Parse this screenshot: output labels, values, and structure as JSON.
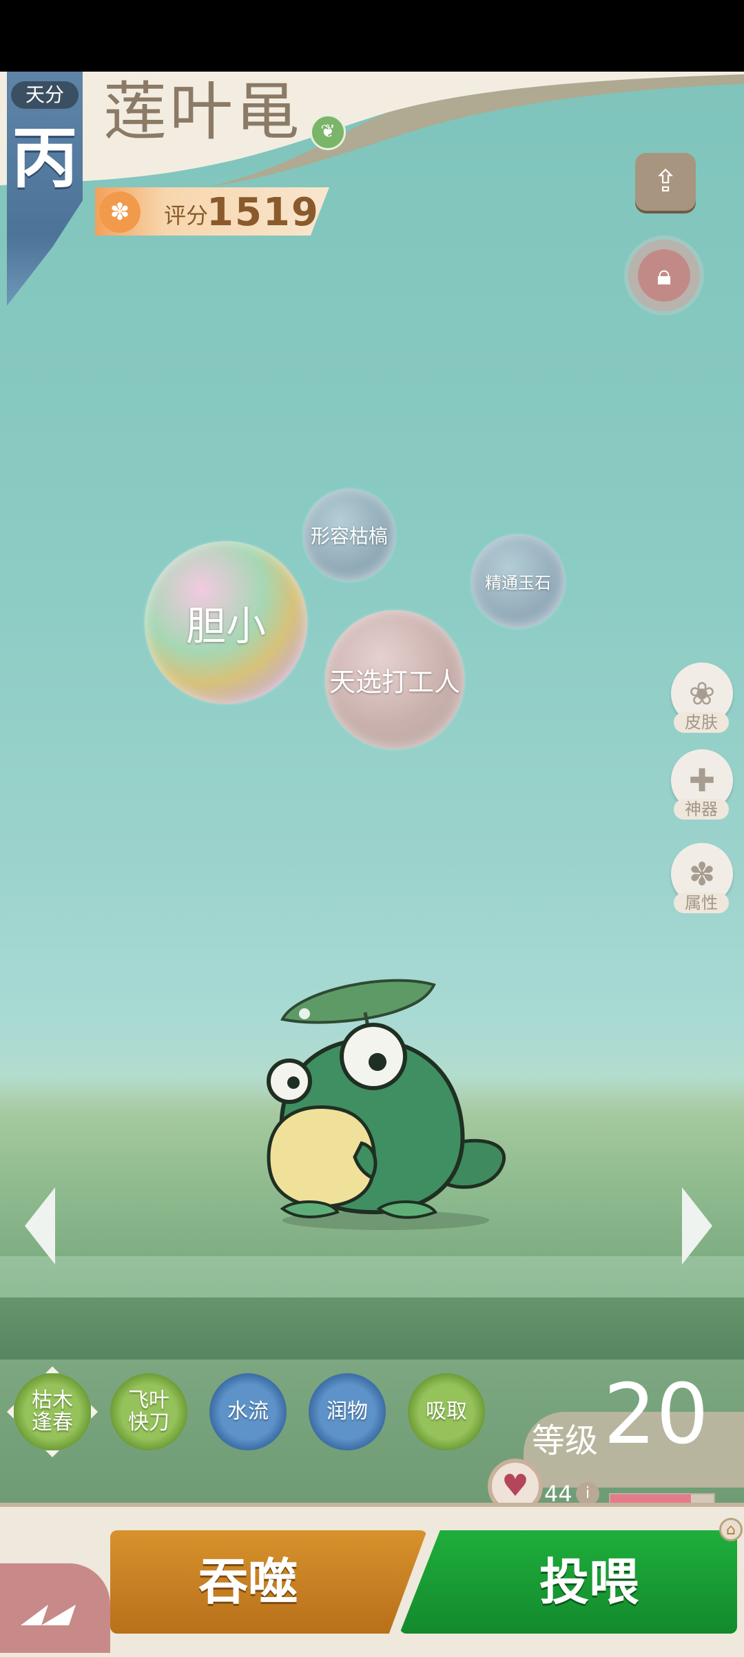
{
  "pet": {
    "rank_label": "天分",
    "rank_value": "丙",
    "name": "莲叶黾",
    "score_label": "评分",
    "score_value": "1519"
  },
  "bubbles": {
    "trait_1": "胆小",
    "trait_2": "形容枯槁",
    "trait_3": "精通玉石",
    "trait_4": "天选打工人"
  },
  "side_menu": {
    "skin": "皮肤",
    "artifact": "神器",
    "attributes": "属性"
  },
  "skills": [
    {
      "label": "枯木\n逢春",
      "type": "green"
    },
    {
      "label": "飞叶\n快刀",
      "type": "green"
    },
    {
      "label": "水流",
      "type": "blue"
    },
    {
      "label": "润物",
      "type": "blue"
    },
    {
      "label": "吸取",
      "type": "green"
    }
  ],
  "level": {
    "label": "等级",
    "value": "20"
  },
  "affection": {
    "value": "44",
    "fill_percent": 78
  },
  "actions": {
    "devour": "吞噬",
    "feed": "投喂"
  },
  "icons": {
    "share": "share-icon",
    "lock": "lock-icon",
    "paw": "paw-icon",
    "butterfly": "butterfly-icon",
    "plus": "plus-icon",
    "heart": "heart-icon",
    "info": "info-icon",
    "arrow_left": "arrow-left-icon",
    "arrow_right": "arrow-right-icon",
    "grass_element": "grass-element-icon"
  },
  "colors": {
    "sky": "#7fc4bc",
    "feed_green": "#1fae3c",
    "devour_orange": "#d7922d",
    "rank_blue": "#5e84a8"
  }
}
